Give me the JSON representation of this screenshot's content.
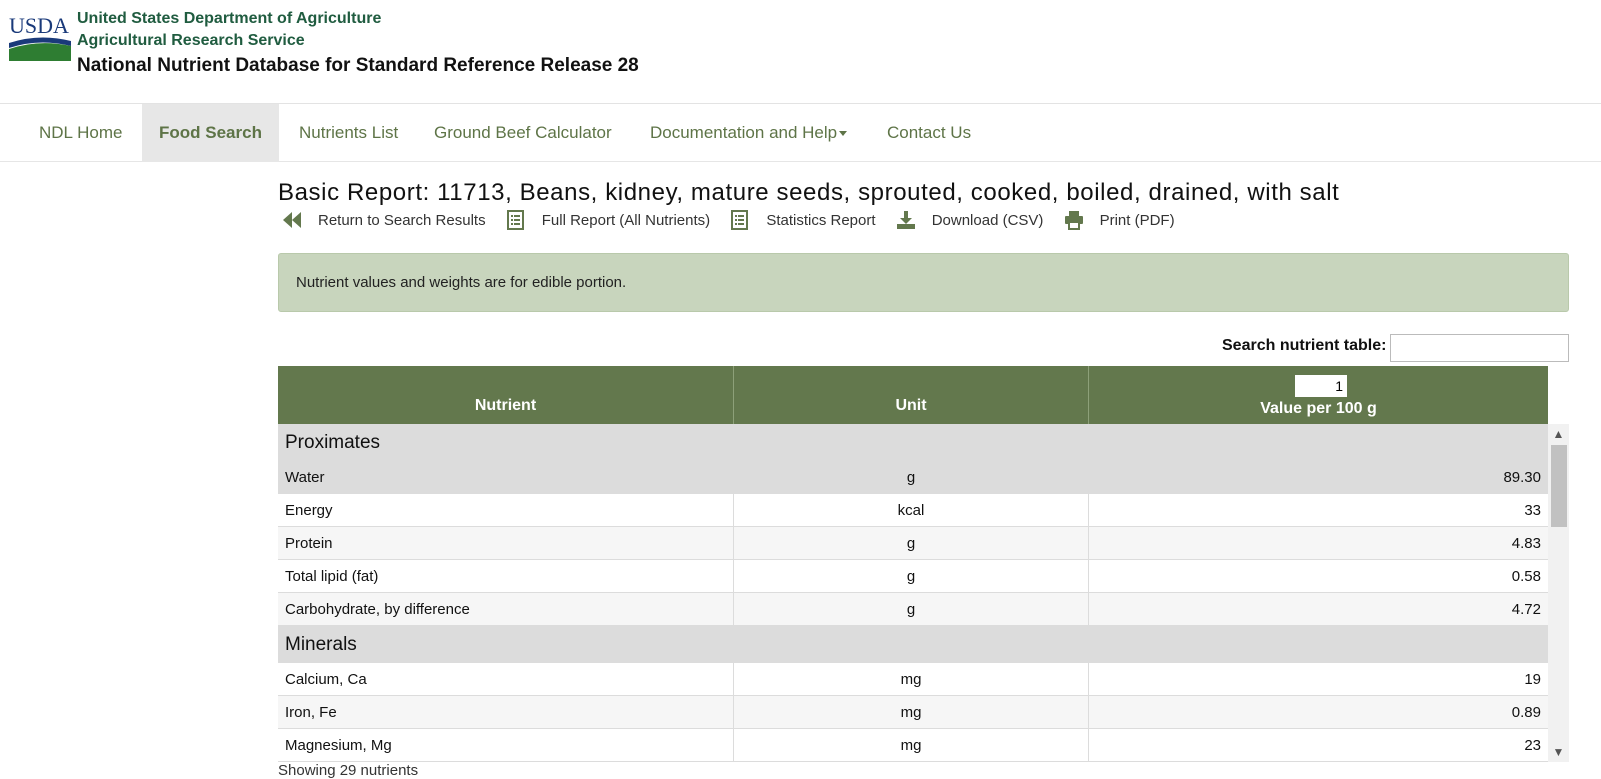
{
  "header": {
    "logo_text": "USDA",
    "agency_line1": "United States Department of Agriculture",
    "agency_line2": "Agricultural Research Service",
    "database_title": "National Nutrient Database for Standard Reference Release 28"
  },
  "nav": {
    "items": [
      {
        "label": "NDL Home"
      },
      {
        "label": "Food Search",
        "active": true
      },
      {
        "label": "Nutrients List"
      },
      {
        "label": "Ground Beef Calculator"
      },
      {
        "label": "Documentation and Help",
        "dropdown": true
      },
      {
        "label": "Contact Us"
      }
    ]
  },
  "report": {
    "title": "Basic Report:  11713, Beans, kidney, mature seeds, sprouted, cooked, boiled, drained, with salt",
    "actions": [
      {
        "label": "Return to Search Results",
        "icon": "double-arrow-left-icon"
      },
      {
        "label": "Full Report (All Nutrients)",
        "icon": "list-document-icon"
      },
      {
        "label": "Statistics Report",
        "icon": "list-document-icon"
      },
      {
        "label": "Download (CSV)",
        "icon": "download-icon"
      },
      {
        "label": "Print (PDF)",
        "icon": "printer-icon"
      }
    ],
    "info_message": "Nutrient values and weights are for edible portion."
  },
  "search": {
    "label": "Search nutrient table:",
    "value": ""
  },
  "table": {
    "headers": {
      "nutrient": "Nutrient",
      "unit": "Unit",
      "value": "Value per 100 g",
      "quantity": "1"
    },
    "groups": [
      {
        "name": "Proximates",
        "rows": [
          {
            "nutrient": "Water",
            "unit": "g",
            "value": "89.30"
          },
          {
            "nutrient": "Energy",
            "unit": "kcal",
            "value": "33"
          },
          {
            "nutrient": "Protein",
            "unit": "g",
            "value": "4.83"
          },
          {
            "nutrient": "Total lipid (fat)",
            "unit": "g",
            "value": "0.58"
          },
          {
            "nutrient": "Carbohydrate, by difference",
            "unit": "g",
            "value": "4.72"
          }
        ]
      },
      {
        "name": "Minerals",
        "rows": [
          {
            "nutrient": "Calcium, Ca",
            "unit": "mg",
            "value": "19"
          },
          {
            "nutrient": "Iron, Fe",
            "unit": "mg",
            "value": "0.89"
          },
          {
            "nutrient": "Magnesium, Mg",
            "unit": "mg",
            "value": "23"
          }
        ]
      }
    ],
    "footer": "Showing 29 nutrients"
  },
  "colors": {
    "brand_green": "#63784d",
    "nav_text": "#5e7447",
    "agency_text": "#205c40",
    "info_bg": "#c8d5bd"
  }
}
